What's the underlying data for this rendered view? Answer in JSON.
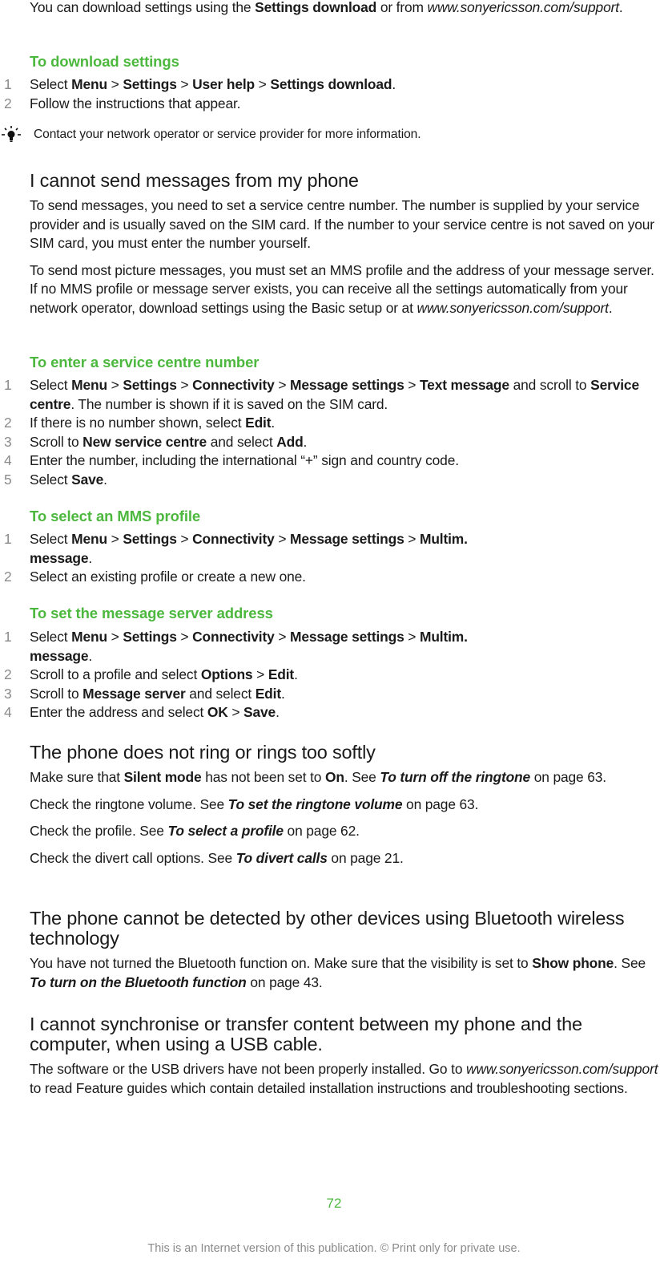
{
  "colors": {
    "accent": "#4cb83e",
    "text": "#1a1a1a",
    "muted": "#8a8a8a"
  },
  "intro": {
    "p1": [
      {
        "t": "You can download settings using the "
      },
      {
        "t": "Settings download",
        "s": "b"
      },
      {
        "t": " or from "
      },
      {
        "t": "www.sonyericsson.com/support",
        "s": "i",
        "link": true
      },
      {
        "t": "."
      }
    ]
  },
  "download_settings": {
    "heading": "To download settings",
    "steps": [
      {
        "n": "1",
        "runs": [
          {
            "t": "Select "
          },
          {
            "t": "Menu",
            "s": "b"
          },
          {
            "t": " > "
          },
          {
            "t": "Settings",
            "s": "b"
          },
          {
            "t": " > "
          },
          {
            "t": "User help",
            "s": "b"
          },
          {
            "t": " > "
          },
          {
            "t": "Settings download",
            "s": "b"
          },
          {
            "t": "."
          }
        ]
      },
      {
        "n": "2",
        "runs": [
          {
            "t": "Follow the instructions that appear."
          }
        ]
      }
    ],
    "tip": {
      "icon": "lightbulb-icon",
      "text": "Contact your network operator or service provider for more information."
    }
  },
  "cannot_send": {
    "heading": "I cannot send messages from my phone",
    "p1": [
      {
        "t": "To send messages, you need to set a service centre number. The number is supplied by your service provider and is usually saved on the SIM card. If the number to your service centre is not saved on your SIM card, you must enter the number yourself."
      }
    ],
    "p2": [
      {
        "t": "To send most picture messages, you must set an MMS profile and the address of your message server. If no MMS profile or message server exists, you can receive all the settings automatically from your network operator, download settings using the Basic setup or at "
      },
      {
        "t": "www.sonyericsson.com/support",
        "s": "i",
        "link": true
      },
      {
        "t": "."
      }
    ]
  },
  "service_centre": {
    "heading": "To enter a service centre number",
    "steps": [
      {
        "n": "1",
        "runs": [
          {
            "t": "Select "
          },
          {
            "t": "Menu",
            "s": "b"
          },
          {
            "t": " > "
          },
          {
            "t": "Settings",
            "s": "b"
          },
          {
            "t": " > "
          },
          {
            "t": "Connectivity",
            "s": "b"
          },
          {
            "t": " > "
          },
          {
            "t": "Message settings",
            "s": "b"
          },
          {
            "t": " > "
          },
          {
            "t": "Text message",
            "s": "b"
          },
          {
            "t": " and scroll to "
          },
          {
            "t": "Service centre",
            "s": "b"
          },
          {
            "t": ". The number is shown if it is saved on the SIM card."
          }
        ]
      },
      {
        "n": "2",
        "runs": [
          {
            "t": "If there is no number shown, select "
          },
          {
            "t": "Edit",
            "s": "b"
          },
          {
            "t": "."
          }
        ]
      },
      {
        "n": "3",
        "runs": [
          {
            "t": "Scroll to "
          },
          {
            "t": "New service centre",
            "s": "b"
          },
          {
            "t": " and select "
          },
          {
            "t": "Add",
            "s": "b"
          },
          {
            "t": "."
          }
        ]
      },
      {
        "n": "4",
        "runs": [
          {
            "t": "Enter the number, including the international “+” sign and country code."
          }
        ]
      },
      {
        "n": "5",
        "runs": [
          {
            "t": "Select "
          },
          {
            "t": "Save",
            "s": "b"
          },
          {
            "t": "."
          }
        ]
      }
    ]
  },
  "mms_profile": {
    "heading": "To select an MMS profile",
    "steps": [
      {
        "n": "1",
        "runs": [
          {
            "t": "Select "
          },
          {
            "t": "Menu",
            "s": "b"
          },
          {
            "t": " > "
          },
          {
            "t": "Settings",
            "s": "b"
          },
          {
            "t": " > "
          },
          {
            "t": "Connectivity",
            "s": "b"
          },
          {
            "t": " > "
          },
          {
            "t": "Message settings",
            "s": "b"
          },
          {
            "t": " > "
          },
          {
            "t": "Multim.",
            "s": "b"
          },
          {
            "br": true
          },
          {
            "t": "message",
            "s": "b"
          },
          {
            "t": "."
          }
        ]
      },
      {
        "n": "2",
        "runs": [
          {
            "t": "Select an existing profile or create a new one."
          }
        ]
      }
    ]
  },
  "server_address": {
    "heading": "To set the message server address",
    "steps": [
      {
        "n": "1",
        "runs": [
          {
            "t": "Select "
          },
          {
            "t": "Menu",
            "s": "b"
          },
          {
            "t": " > "
          },
          {
            "t": "Settings",
            "s": "b"
          },
          {
            "t": " > "
          },
          {
            "t": "Connectivity",
            "s": "b"
          },
          {
            "t": " > "
          },
          {
            "t": "Message settings",
            "s": "b"
          },
          {
            "t": " > "
          },
          {
            "t": "Multim.",
            "s": "b"
          },
          {
            "br": true
          },
          {
            "t": "message",
            "s": "b"
          },
          {
            "t": "."
          }
        ]
      },
      {
        "n": "2",
        "runs": [
          {
            "t": "Scroll to a profile and select "
          },
          {
            "t": "Options",
            "s": "b"
          },
          {
            "t": " > "
          },
          {
            "t": "Edit",
            "s": "b"
          },
          {
            "t": "."
          }
        ]
      },
      {
        "n": "3",
        "runs": [
          {
            "t": "Scroll to "
          },
          {
            "t": "Message server",
            "s": "b"
          },
          {
            "t": " and select "
          },
          {
            "t": "Edit",
            "s": "b"
          },
          {
            "t": "."
          }
        ]
      },
      {
        "n": "4",
        "runs": [
          {
            "t": "Enter the address and select "
          },
          {
            "t": "OK",
            "s": "b"
          },
          {
            "t": " > "
          },
          {
            "t": "Save",
            "s": "b"
          },
          {
            "t": "."
          }
        ]
      }
    ]
  },
  "no_ring": {
    "heading": "The phone does not ring or rings too softly",
    "paragraphs": [
      [
        {
          "t": "Make sure that "
        },
        {
          "t": "Silent mode",
          "s": "b"
        },
        {
          "t": " has not been set to "
        },
        {
          "t": "On",
          "s": "b"
        },
        {
          "t": ". See "
        },
        {
          "t": "To turn off the ringtone",
          "s": "bi",
          "link": true
        },
        {
          "t": " on page 63."
        }
      ],
      [
        {
          "t": "Check the ringtone volume. See "
        },
        {
          "t": "To set the ringtone volume",
          "s": "bi",
          "link": true
        },
        {
          "t": " on page 63."
        }
      ],
      [
        {
          "t": "Check the profile. See "
        },
        {
          "t": "To select a profile",
          "s": "bi",
          "link": true
        },
        {
          "t": " on page 62."
        }
      ],
      [
        {
          "t": "Check the divert call options. See "
        },
        {
          "t": "To divert calls",
          "s": "bi",
          "link": true
        },
        {
          "t": " on page 21."
        }
      ]
    ]
  },
  "bluetooth": {
    "heading": "The phone cannot be detected by other devices using Bluetooth wireless technology",
    "p1": [
      {
        "t": "You have not turned the Bluetooth function on. Make sure that the visibility is set to "
      },
      {
        "t": "Show phone",
        "s": "b"
      },
      {
        "t": ". See "
      },
      {
        "t": "To turn on the Bluetooth function",
        "s": "bi",
        "link": true
      },
      {
        "t": " on page 43."
      }
    ]
  },
  "usb": {
    "heading": "I cannot synchronise or transfer content between my phone and the computer, when using a USB cable.",
    "p1": [
      {
        "t": "The software or the USB drivers have not been properly installed. Go to "
      },
      {
        "t": "www.sonyericsson.com/support",
        "s": "i",
        "link": true
      },
      {
        "t": " to read Feature guides which contain detailed installation instructions and troubleshooting sections."
      }
    ]
  },
  "footer": {
    "page_number": "72",
    "notice": "This is an Internet version of this publication. © Print only for private use."
  }
}
